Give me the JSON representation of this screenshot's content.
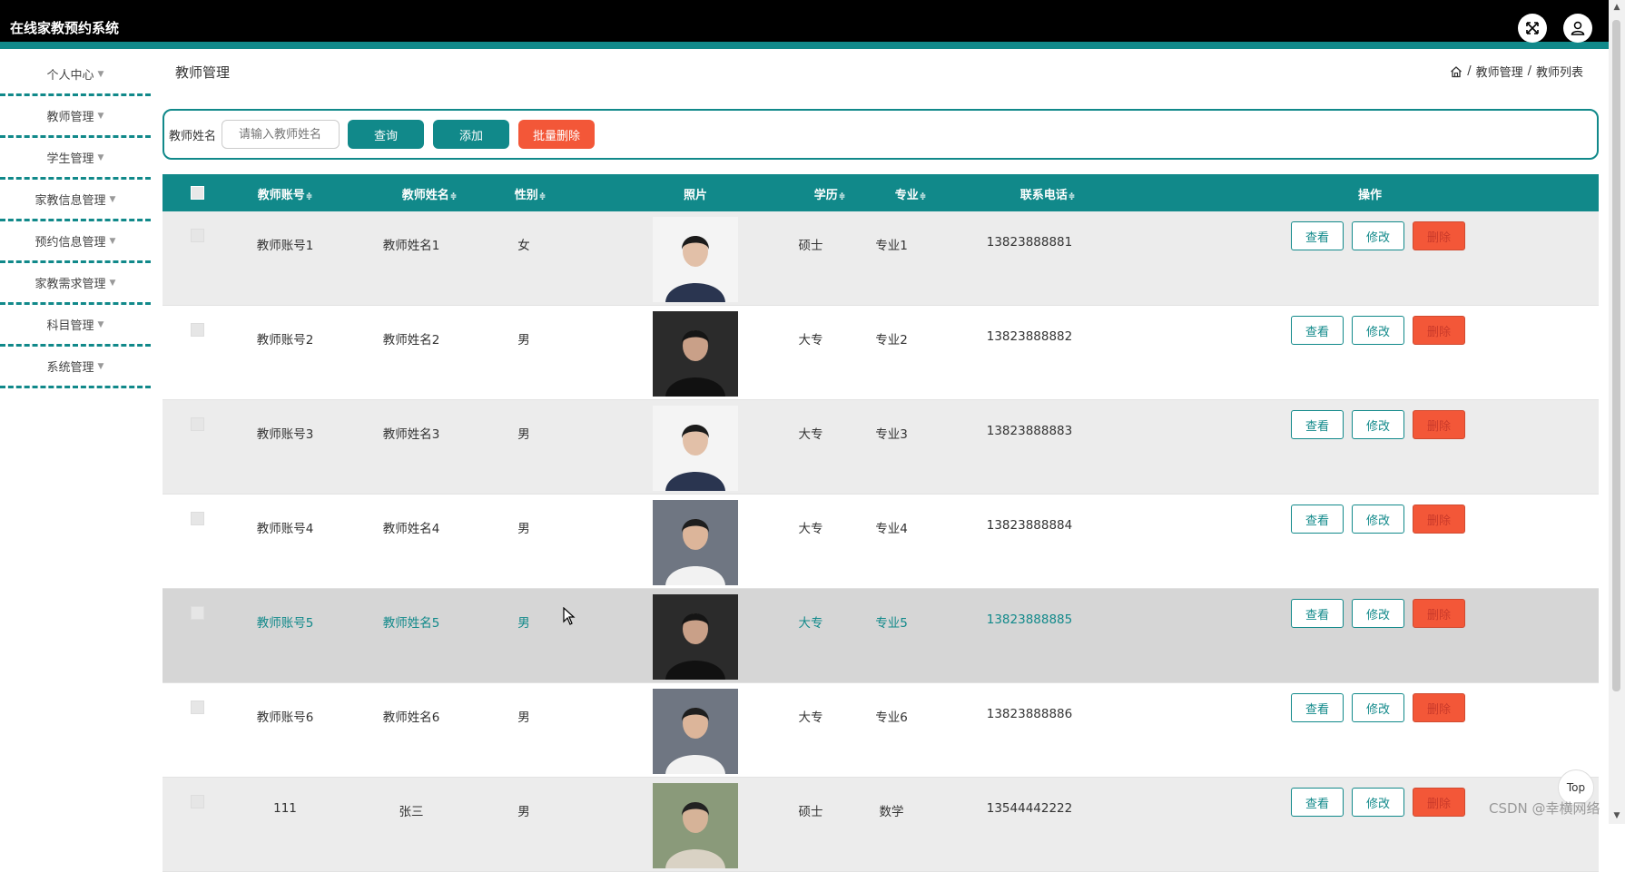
{
  "app": {
    "title": "在线家教预约系统"
  },
  "sidebar": {
    "items": [
      {
        "label": "个人中心"
      },
      {
        "label": "教师管理"
      },
      {
        "label": "学生管理"
      },
      {
        "label": "家教信息管理"
      },
      {
        "label": "预约信息管理"
      },
      {
        "label": "家教需求管理"
      },
      {
        "label": "科目管理"
      },
      {
        "label": "系统管理"
      }
    ]
  },
  "page": {
    "title": "教师管理"
  },
  "breadcrumb": {
    "items": [
      "教师管理",
      "教师列表"
    ],
    "separator": "/"
  },
  "search": {
    "label": "教师姓名",
    "placeholder": "请输入教师姓名",
    "query_button": "查询",
    "add_button": "添加",
    "batch_delete_button": "批量删除"
  },
  "table": {
    "headers": {
      "account": "教师账号",
      "name": "教师姓名",
      "gender": "性别",
      "photo": "照片",
      "education": "学历",
      "major": "专业",
      "phone": "联系电话",
      "actions": "操作"
    },
    "sort_glyph": "≑",
    "action_labels": {
      "view": "查看",
      "edit": "修改",
      "delete": "删除"
    },
    "rows": [
      {
        "account": "教师账号1",
        "name": "教师姓名1",
        "gender": "女",
        "education": "硕士",
        "major": "专业1",
        "phone": "13823888881",
        "photo_tone": "light"
      },
      {
        "account": "教师账号2",
        "name": "教师姓名2",
        "gender": "男",
        "education": "大专",
        "major": "专业2",
        "phone": "13823888882",
        "photo_tone": "dark"
      },
      {
        "account": "教师账号3",
        "name": "教师姓名3",
        "gender": "男",
        "education": "大专",
        "major": "专业3",
        "phone": "13823888883",
        "photo_tone": "light"
      },
      {
        "account": "教师账号4",
        "name": "教师姓名4",
        "gender": "男",
        "education": "大专",
        "major": "专业4",
        "phone": "13823888884",
        "photo_tone": "grey"
      },
      {
        "account": "教师账号5",
        "name": "教师姓名5",
        "gender": "男",
        "education": "大专",
        "major": "专业5",
        "phone": "13823888885",
        "photo_tone": "dark"
      },
      {
        "account": "教师账号6",
        "name": "教师姓名6",
        "gender": "男",
        "education": "大专",
        "major": "专业6",
        "phone": "13823888886",
        "photo_tone": "grey"
      },
      {
        "account": "111",
        "name": "张三",
        "gender": "男",
        "education": "硕士",
        "major": "数学",
        "phone": "13544442222",
        "photo_tone": "mixed"
      }
    ]
  },
  "back_to_top": "Top",
  "watermark": "CSDN @幸横网络",
  "colors": {
    "accent": "#11898a",
    "danger": "#f35738",
    "topbar": "#000000"
  }
}
